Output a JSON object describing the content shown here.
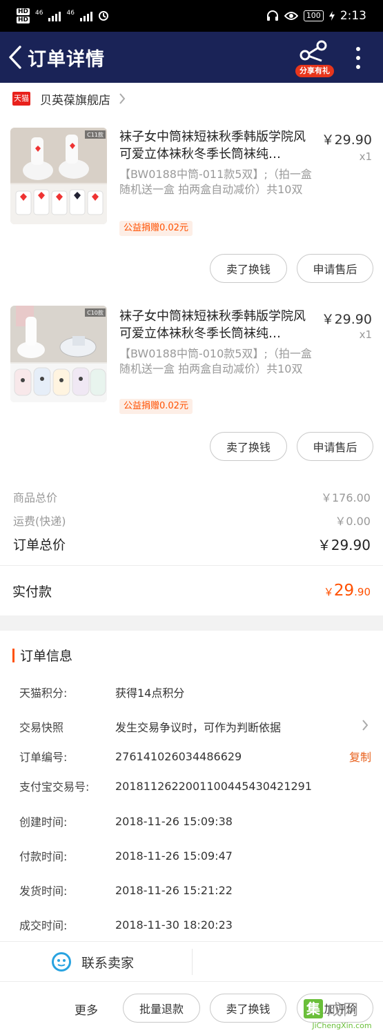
{
  "status_bar": {
    "sim1": "HD",
    "sim2": "HD",
    "net1": "46",
    "net2": "46",
    "battery": "100",
    "time": "2:13"
  },
  "header": {
    "title": "订单详情",
    "share_label": "分享有礼"
  },
  "store": {
    "badge": "天猫",
    "name": "贝英葆旗舰店"
  },
  "products": [
    {
      "title": "袜子女中筒袜短袜秋季韩版学院风可爱立体袜秋冬季长筒袜纯…",
      "sku": "【BW0188中筒-011款5双】;（拍一盒随机送一盒 拍两盒自动减价）共10双",
      "price": "￥29.90",
      "qty": "x1",
      "tag": "公益捐赠0.02元",
      "img_label": "C11款",
      "btn_sell": "卖了换钱",
      "btn_after": "申请售后"
    },
    {
      "title": "袜子女中筒袜短袜秋季韩版学院风可爱立体袜秋冬季长筒袜纯…",
      "sku": "【BW0188中筒-010款5双】;（拍一盒随机送一盒 拍两盒自动减价）共10双",
      "price": "￥29.90",
      "qty": "x1",
      "tag": "公益捐赠0.02元",
      "img_label": "C10款",
      "btn_sell": "卖了换钱",
      "btn_after": "申请售后"
    }
  ],
  "totals": {
    "goods_label": "商品总价",
    "goods_value": "￥176.00",
    "shipping_label": "运费(快递)",
    "shipping_value": "￥0.00",
    "order_total_label": "订单总价",
    "order_total_value": "￥29.90",
    "paid_label": "实付款",
    "paid_yen": "￥",
    "paid_int": "29",
    "paid_dec": ".90"
  },
  "order_info": {
    "heading": "订单信息",
    "rows": [
      {
        "key": "天猫积分:",
        "value": "获得14点积分"
      },
      {
        "key": "交易快照",
        "value": "发生交易争议时，可作为判断依据"
      },
      {
        "key": "订单编号:",
        "value": "276141026034486629"
      },
      {
        "key": "支付宝交易号:",
        "value": "2018112622001100445430421291"
      },
      {
        "key": "创建时间:",
        "value": "2018-11-26 15:09:38"
      },
      {
        "key": "付款时间:",
        "value": "2018-11-26 15:09:47"
      },
      {
        "key": "发货时间:",
        "value": "2018-11-26 15:21:22"
      },
      {
        "key": "成交时间:",
        "value": "2018-11-30 18:20:23"
      }
    ],
    "copy_label": "复制"
  },
  "bottom": {
    "contact_label": "联系卖家",
    "more_label": "更多",
    "batch_refund": "批量退款",
    "sell_for_cash": "卖了换钱",
    "add_review": "追加评价"
  },
  "watermark": {
    "glyph": "集",
    "cn": "成网",
    "en": "JiChengXin.com"
  },
  "colors": {
    "header_bg": "#1a2357",
    "accent": "#ff5000",
    "tmall_red": "#e8211c"
  }
}
